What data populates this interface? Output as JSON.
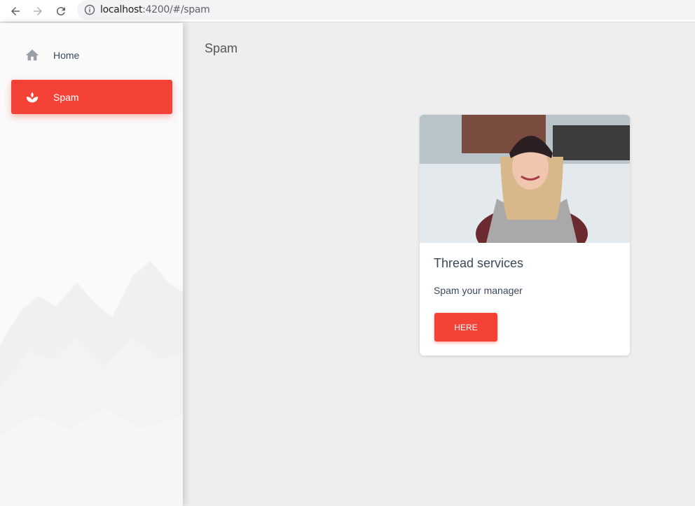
{
  "browser": {
    "url_host": "localhost",
    "url_rest": ":4200/#/spam",
    "back_icon": "arrow-left-icon",
    "forward_icon": "arrow-right-icon",
    "reload_icon": "reload-icon",
    "info_icon": "info-icon"
  },
  "sidebar": {
    "items": [
      {
        "label": "Home",
        "icon": "home-icon",
        "active": false
      },
      {
        "label": "Spam",
        "icon": "spa-icon",
        "active": true
      }
    ]
  },
  "main": {
    "page_title": "Spam",
    "card": {
      "title": "Thread services",
      "description": "Spam your manager",
      "button_label": "HERE"
    }
  },
  "colors": {
    "accent": "#f44336",
    "page_bg": "#eeeeee",
    "sidebar_bg": "#fafafa",
    "text": "#3c4858"
  }
}
